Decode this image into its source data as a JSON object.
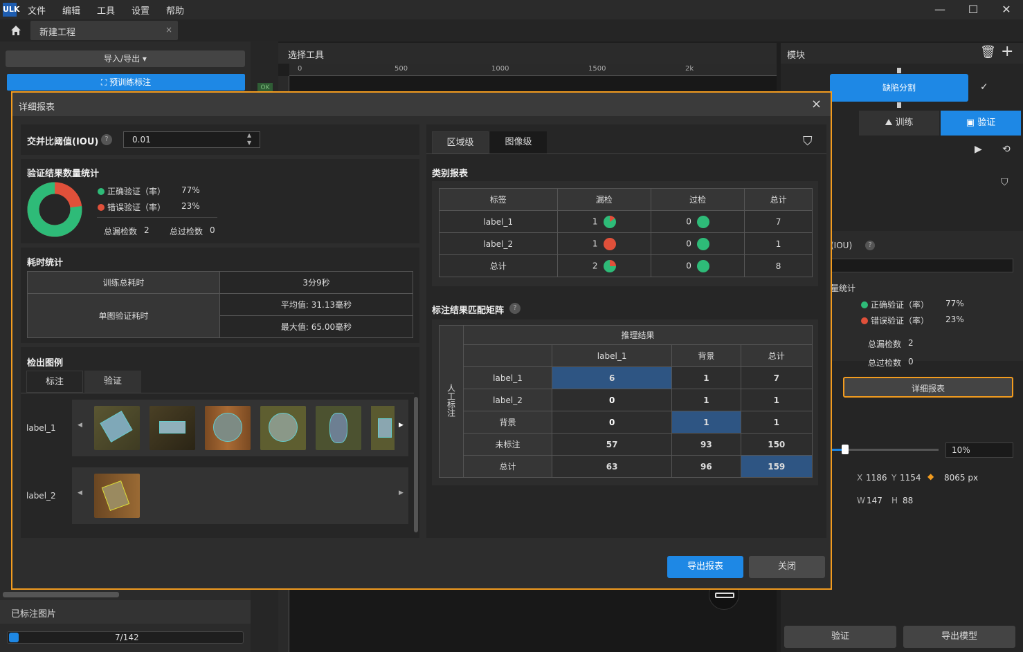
{
  "app": {
    "logo": "ULK",
    "menus": [
      "文件",
      "编辑",
      "工具",
      "设置",
      "帮助"
    ]
  },
  "tabs": {
    "home_tab": "新建工程",
    "close": "×"
  },
  "left": {
    "import_export": "导入/导出",
    "pretrain": "预训练标注",
    "labeled_images": "已标注图片",
    "progress": "7/142",
    "ok_tag": "OK"
  },
  "center": {
    "tool_title": "选择工具",
    "ruler": [
      "0",
      "500",
      "1000",
      "1500",
      "2k"
    ]
  },
  "right": {
    "module_title": "模块",
    "module_name": "缺陷分割",
    "tab_train": "训练",
    "tab_verify": "验证",
    "iou_label": "(IOU)",
    "stat_title": "量统计",
    "correct_label": "正确验证（率）",
    "correct_value": "77%",
    "wrong_label": "错误验证（率）",
    "wrong_value": "23%",
    "miss_label": "总漏检数",
    "miss_value": "2",
    "over_label": "总过检数",
    "over_value": "0",
    "detail_btn": "详细报表",
    "zoom": "10%",
    "x_label": "X",
    "x_value": "1186",
    "y_label": "Y",
    "y_value": "1154",
    "px_value": "8065 px",
    "w_label": "W",
    "w_value": "147",
    "h_label": "H",
    "h_value": "88",
    "verify_btn": "验证",
    "export_model_btn": "导出模型"
  },
  "modal": {
    "title": "详细报表",
    "close": "×",
    "iou": {
      "label": "交并比阈值(IOU)",
      "value": "0.01"
    },
    "stats": {
      "title": "验证结果数量统计",
      "correct_label": "正确验证（率）",
      "correct_value": "77%",
      "wrong_label": "错误验证（率）",
      "wrong_value": "23%",
      "miss_label": "总漏检数",
      "miss_value": "2",
      "over_label": "总过检数",
      "over_value": "0",
      "correct_ratio": 0.77,
      "color_correct": "#2ebb78",
      "color_wrong": "#e0503a"
    },
    "time": {
      "title": "耗时统计",
      "train_label": "训练总耗时",
      "train_value": "3分9秒",
      "single_label": "单图验证耗时",
      "avg": "平均值: 31.13毫秒",
      "max": "最大值: 65.00毫秒"
    },
    "examples": {
      "title": "检出图例",
      "tab1": "标注",
      "tab2": "验证",
      "row1": "label_1",
      "row2": "label_2"
    },
    "right_tabs": {
      "tab1": "区域级",
      "tab2": "图像级"
    },
    "class_report": {
      "title": "类别报表",
      "headers": [
        "标签",
        "漏检",
        "过检",
        "总计"
      ],
      "rows": [
        {
          "label": "label_1",
          "miss": "1",
          "over": "0",
          "total": "7",
          "miss_ratio": 0.15
        },
        {
          "label": "label_2",
          "miss": "1",
          "over": "0",
          "total": "1",
          "miss_ratio": 1.0
        },
        {
          "label": "总计",
          "miss": "2",
          "over": "0",
          "total": "8",
          "miss_ratio": 0.25
        }
      ]
    },
    "matrix": {
      "title": "标注结果匹配矩阵",
      "infer": "推理结果",
      "actual": "人工标注",
      "cols": [
        "label_1",
        "背景",
        "总计"
      ],
      "rows": [
        {
          "label": "label_1",
          "v": [
            "6",
            "1",
            "7"
          ]
        },
        {
          "label": "label_2",
          "v": [
            "0",
            "1",
            "1"
          ]
        },
        {
          "label": "背景",
          "v": [
            "0",
            "1",
            "1"
          ]
        },
        {
          "label": "未标注",
          "v": [
            "57",
            "93",
            "150"
          ]
        },
        {
          "label": "总计",
          "v": [
            "63",
            "96",
            "159"
          ]
        }
      ]
    },
    "export_btn": "导出报表",
    "close_btn": "关闭"
  }
}
